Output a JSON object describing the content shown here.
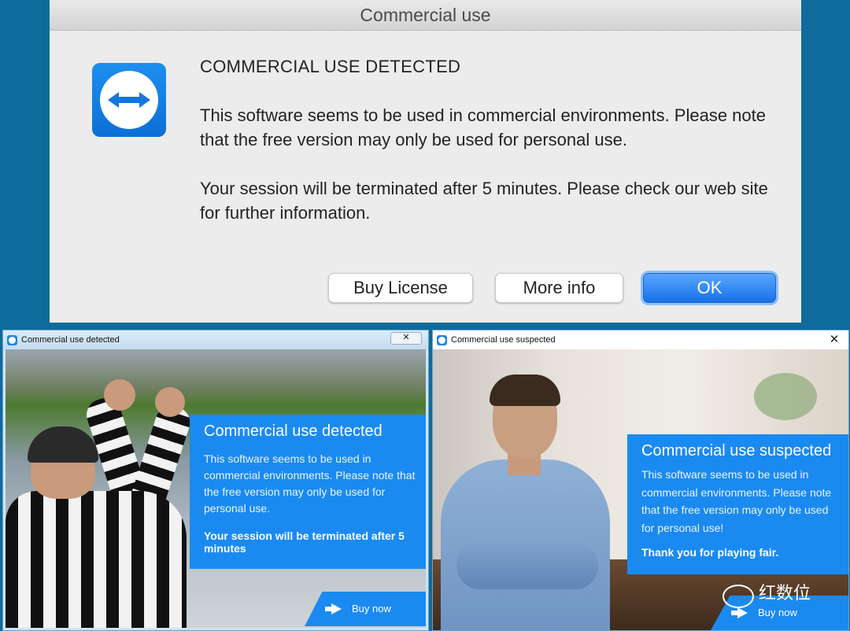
{
  "mac_dialog": {
    "title": "Commercial use",
    "heading": "COMMERCIAL USE DETECTED",
    "body_1": "This software seems to be used in commercial environments. Please note that the free version may only be used for personal use.",
    "body_2": "Your session will be terminated after 5 minutes. Please check our web site for further information.",
    "buttons": {
      "buy_license": "Buy License",
      "more_info": "More info",
      "ok": "OK"
    },
    "icon": "teamviewer-logo-icon"
  },
  "win_detected": {
    "title": "Commercial use detected",
    "close": "✕",
    "heading": "Commercial use detected",
    "body": "This software seems to be used in commercial environments. Please note that the free version may only be used for personal use.",
    "bold": "Your session will be terminated after 5 minutes",
    "buy_now": "Buy now"
  },
  "win_suspected": {
    "title": "Commercial use suspected",
    "close": "✕",
    "heading": "Commercial use suspected",
    "body": "This software seems to be used in commercial environments. Please note that the free version may only be used for personal use!",
    "bold": "Thank you for playing fair.",
    "buy_now": "Buy now"
  },
  "watermark": {
    "text": "红数位",
    "icon": "wechat-icon"
  },
  "colors": {
    "accent_blue": "#1b8af0",
    "background": "#0f6b9c",
    "dialog_bg": "#ececec"
  }
}
